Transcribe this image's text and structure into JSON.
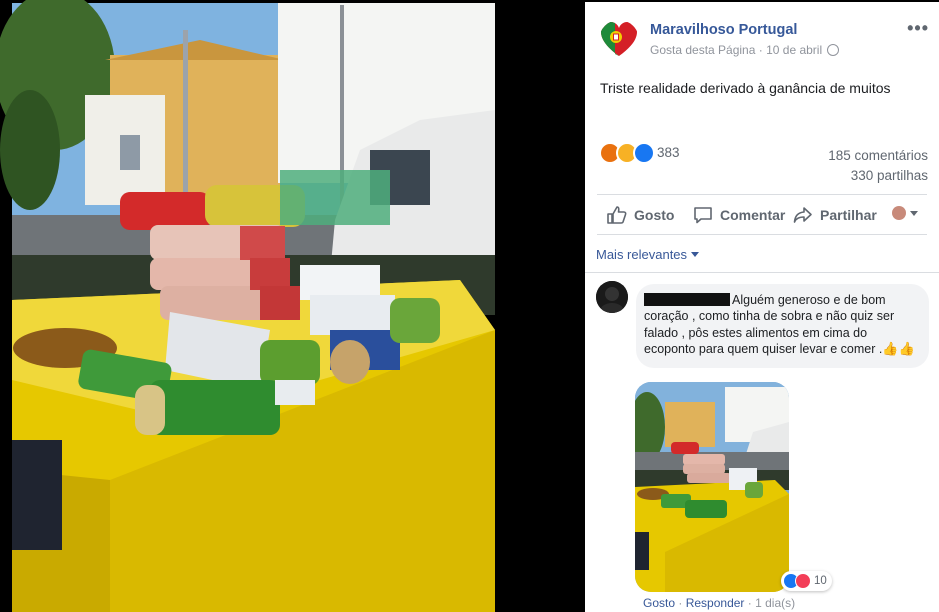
{
  "post": {
    "page_name": "Maravilhoso Portugal",
    "like_page": "Gosta desta Página",
    "date": "10 de abril",
    "text": "Triste realidade derivado à ganância de muitos",
    "reaction_count": "383",
    "comments_count": "185 comentários",
    "shares_count": "330 partilhas"
  },
  "actions": {
    "like": "Gosto",
    "comment": "Comentar",
    "share": "Partilhar"
  },
  "comments": {
    "sort_label": "Mais relevantes",
    "first": {
      "text": "Alguém generoso e de bom coração , como tinha de sobra e não quiz ser falado , pôs estes alimentos em cima do ecoponto para quem quiser levar e comer .",
      "thumbs": "👍👍",
      "reaction_count": "10",
      "like": "Gosto",
      "reply": "Responder",
      "time": "1 dia(s)"
    }
  },
  "colors": {
    "link": "#365899",
    "bin_yellow": "#e6c800",
    "background": "#000000"
  },
  "icons": [
    "globe-icon",
    "more-options-icon",
    "like-icon",
    "comment-icon",
    "share-icon",
    "angry-reaction-icon",
    "sad-reaction-icon",
    "like-reaction-icon",
    "heart-reaction-icon"
  ]
}
